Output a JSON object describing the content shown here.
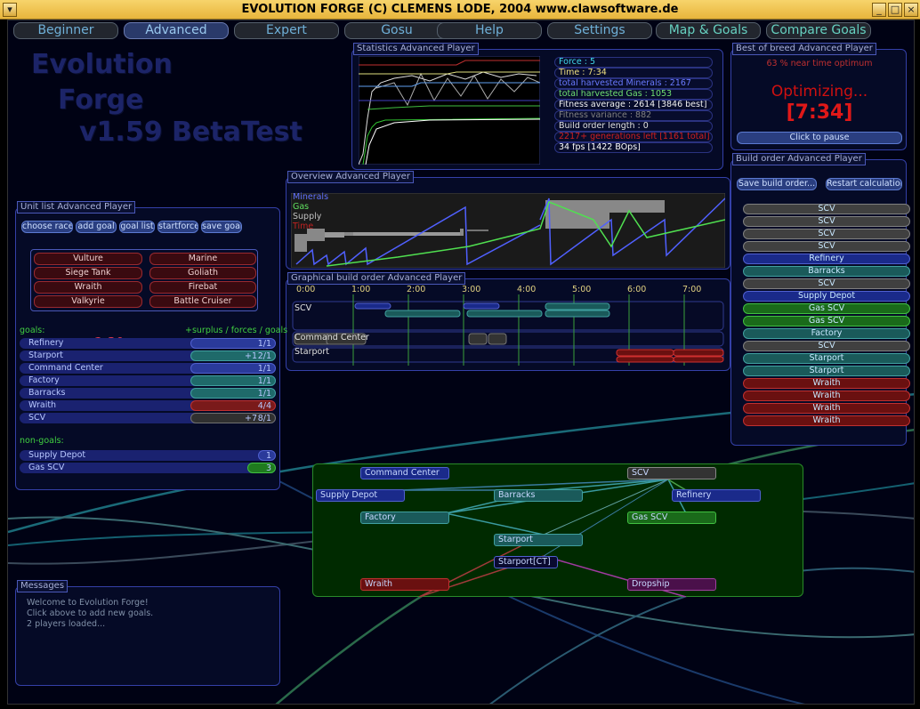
{
  "window": {
    "title": "EVOLUTION FORGE (C) CLEMENS LODE, 2004 www.clawsoftware.de"
  },
  "tabs": [
    "Beginner",
    "Advanced",
    "Expert",
    "Gosu",
    "Help",
    "Settings",
    "Map & Goals",
    "Compare Goals"
  ],
  "logo": [
    "Evolution",
    "Forge",
    "v1.59 BetaTest"
  ],
  "statistics": {
    "title": "Statistics Advanced Player",
    "rows": [
      {
        "text": "Force : 5",
        "color": "#40d8e8"
      },
      {
        "text": "Time : 7:34",
        "color": "#f0e080"
      },
      {
        "text": "total harvested Minerals : 2167",
        "color": "#6a7aff"
      },
      {
        "text": "total harvested Gas : 1053",
        "color": "#70e070"
      },
      {
        "text": "Fitness average : 2614 [3846 best]",
        "color": "#f0f0f0"
      },
      {
        "text": "Fitness variance : 882",
        "color": "#808080"
      },
      {
        "text": "Build order length : 0",
        "color": "#e0e0e0"
      },
      {
        "text": "2217+ generations left [1161 total]",
        "color": "#d02020"
      },
      {
        "text": "34 fps [1422 BOps]",
        "color": "#ffffff"
      }
    ]
  },
  "best": {
    "title": "Best of breed Advanced Player",
    "optimum": "63 % near time optimum",
    "status": "Optimizing...",
    "time": "[7:34]",
    "pause": "Click to pause"
  },
  "overview": {
    "title": "Overview Advanced Player",
    "legend": [
      {
        "text": "Minerals",
        "color": "#6070ff"
      },
      {
        "text": "Gas",
        "color": "#60e060"
      },
      {
        "text": "Supply",
        "color": "#c0c0c0"
      },
      {
        "text": "Time",
        "color": "#c02020"
      }
    ]
  },
  "graphical": {
    "title": "Graphical build order Advanced Player",
    "times": [
      "0:00",
      "1:00",
      "2:00",
      "3:00",
      "4:00",
      "5:00",
      "6:00",
      "7:00"
    ],
    "lanes": [
      "SCV",
      "Command Center",
      "Starport"
    ]
  },
  "unitlist": {
    "title": "Unit list Advanced Player",
    "buttons": [
      "choose race",
      "add goal",
      "goal list",
      "startforce",
      "save goal"
    ],
    "units": [
      "Vulture",
      "Marine",
      "Siege Tank",
      "Goliath",
      "Wraith",
      "Firebat",
      "Valkyrie",
      "Battle Cruiser"
    ],
    "goals_label": "goals:",
    "goals_header": "+surplus / forces / goals",
    "clock": "2:30",
    "goals": [
      {
        "name": "Refinery",
        "surplus": "",
        "value": "1/1",
        "color": "#2a3a9a"
      },
      {
        "name": "Starport",
        "surplus": "+1",
        "value": "2/1",
        "color": "#1f6a6a"
      },
      {
        "name": "Command Center",
        "surplus": "",
        "value": "1/1",
        "color": "#2a3a9a"
      },
      {
        "name": "Factory",
        "surplus": "",
        "value": "1/1",
        "color": "#1f6a6a"
      },
      {
        "name": "Barracks",
        "surplus": "",
        "value": "1/1",
        "color": "#1f6a6a"
      },
      {
        "name": "Wraith",
        "surplus": "",
        "value": "4/4",
        "color": "#7a1a1a"
      },
      {
        "name": "SCV",
        "surplus": "+7",
        "value": "8/1",
        "color": "#404040"
      }
    ],
    "nongoals_label": "non-goals:",
    "nongoals": [
      {
        "name": "Supply Depot",
        "value": "1",
        "color": "#2a3a9a"
      },
      {
        "name": "Gas SCV",
        "value": "3",
        "color": "#1f7a1f"
      }
    ]
  },
  "messages": {
    "title": "Messages",
    "lines": [
      "Welcome to Evolution Forge!",
      "Click above to add new goals.",
      "2 players loaded..."
    ]
  },
  "buildorder": {
    "title": "Build order Advanced Player",
    "save": "Save build order...",
    "restart": "Restart calculation",
    "items": [
      {
        "name": "SCV",
        "color": "#404040"
      },
      {
        "name": "SCV",
        "color": "#404040"
      },
      {
        "name": "SCV",
        "color": "#404040"
      },
      {
        "name": "SCV",
        "color": "#404040"
      },
      {
        "name": "Refinery",
        "color": "#1a2a8a"
      },
      {
        "name": "Barracks",
        "color": "#1a5a5a"
      },
      {
        "name": "SCV",
        "color": "#404040"
      },
      {
        "name": "Supply Depot",
        "color": "#1a2a8a"
      },
      {
        "name": "Gas SCV",
        "color": "#1a6a1a"
      },
      {
        "name": "Gas SCV",
        "color": "#1a6a1a"
      },
      {
        "name": "Factory",
        "color": "#1a5a5a"
      },
      {
        "name": "SCV",
        "color": "#404040"
      },
      {
        "name": "Starport",
        "color": "#1a5a5a"
      },
      {
        "name": "Starport",
        "color": "#1a5a5a"
      },
      {
        "name": "Wraith",
        "color": "#6a1010"
      },
      {
        "name": "Wraith",
        "color": "#6a1010"
      },
      {
        "name": "Wraith",
        "color": "#6a1010"
      },
      {
        "name": "Wraith",
        "color": "#6a1010"
      }
    ]
  },
  "techtree": {
    "nodes": [
      "Command Center",
      "SCV",
      "Supply Depot",
      "Barracks",
      "Refinery",
      "Factory",
      "Gas SCV",
      "Starport",
      "Starport[CT]",
      "Wraith",
      "Dropship"
    ]
  }
}
